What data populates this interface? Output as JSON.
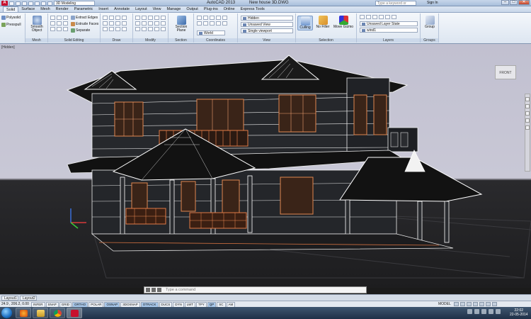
{
  "app": {
    "title": "AutoCAD 2013",
    "file": "New house 3D.DWG",
    "workspace": "3D Modeling",
    "search_placeholder": "Type a keyword or phrase",
    "signin": "Sign In",
    "brand_letter": "A"
  },
  "menu_tabs": [
    "Solid",
    "Surface",
    "Mesh",
    "Render",
    "Parametric",
    "Insert",
    "Annotate",
    "Layout",
    "View",
    "Manage",
    "Output",
    "Plug-ins",
    "Online",
    "Express Tools"
  ],
  "ribbon": {
    "modeling": {
      "polysolid": "Polysolid",
      "presspull": "Presspull"
    },
    "mesh": {
      "smooth": "Smooth Object",
      "title": "Mesh"
    },
    "solid_editing": {
      "extract_edges": "Extract Edges",
      "extrude_faces": "Extrude Faces",
      "separate": "Separate",
      "title": "Solid Editing"
    },
    "draw": {
      "title": "Draw"
    },
    "modify": {
      "title": "Modify"
    },
    "section": {
      "plane": "Section Plane",
      "title": "Section"
    },
    "coordinates": {
      "world": "World",
      "title": "Coordinates"
    },
    "view": {
      "visual_style": "Hidden",
      "saved_view": "Unsaved View",
      "viewport": "Single viewport",
      "title": "View"
    },
    "selection": {
      "culling": "Culling",
      "no_filter": "No Filter",
      "move_gizmo": "Move Gizmo",
      "title": "Selection"
    },
    "layers": {
      "state": "Unsaved Layer State",
      "current": "wind1",
      "title": "Layers"
    },
    "groups": {
      "group": "Group",
      "title": "Groups"
    }
  },
  "viewport": {
    "label": "[Hidden]",
    "viewcube": "FRONT"
  },
  "command_line": {
    "placeholder": "Type a command"
  },
  "layout_tabs": [
    "Layout1",
    "Layout2"
  ],
  "status": {
    "coords": "24.9 , 206.2, 0.00",
    "toggles": [
      {
        "label": "INFER",
        "on": false
      },
      {
        "label": "SNAP",
        "on": false
      },
      {
        "label": "GRID",
        "on": false
      },
      {
        "label": "ORTHO",
        "on": true
      },
      {
        "label": "POLAR",
        "on": false
      },
      {
        "label": "OSNAP",
        "on": true
      },
      {
        "label": "3DOSNAP",
        "on": false
      },
      {
        "label": "OTRACK",
        "on": true
      },
      {
        "label": "DUCS",
        "on": false
      },
      {
        "label": "DYN",
        "on": false
      },
      {
        "label": "LWT",
        "on": false
      },
      {
        "label": "TPY",
        "on": false
      },
      {
        "label": "QP",
        "on": true
      },
      {
        "label": "SC",
        "on": false
      },
      {
        "label": "AM",
        "on": false
      }
    ],
    "model": "MODEL"
  },
  "taskbar": {
    "time": "22:02",
    "date": "22-05-2014"
  },
  "colors": {
    "building_outline": "#f0f0f0",
    "railing": "#e07a45",
    "roof": "#151515",
    "sky": "#c4c3d3",
    "ground": "#1f1f21"
  }
}
